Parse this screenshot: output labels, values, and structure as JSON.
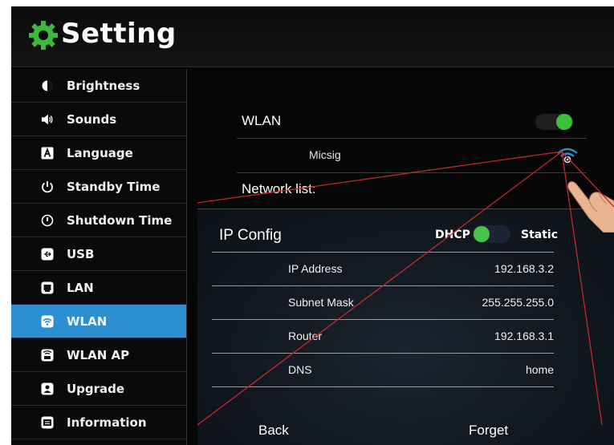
{
  "app": {
    "title": "Setting"
  },
  "sidebar": {
    "items": [
      {
        "label": "Brightness",
        "icon": "brightness-icon"
      },
      {
        "label": "Sounds",
        "icon": "speaker-icon"
      },
      {
        "label": "Language",
        "icon": "language-icon"
      },
      {
        "label": "Standby Time",
        "icon": "power-icon"
      },
      {
        "label": "Shutdown Time",
        "icon": "shutdown-icon"
      },
      {
        "label": "USB",
        "icon": "usb-icon"
      },
      {
        "label": "LAN",
        "icon": "lan-icon"
      },
      {
        "label": "WLAN",
        "icon": "wifi-icon",
        "active": true
      },
      {
        "label": "WLAN AP",
        "icon": "wlan-ap-icon"
      },
      {
        "label": "Upgrade",
        "icon": "upgrade-icon"
      },
      {
        "label": "Information",
        "icon": "information-icon"
      }
    ]
  },
  "wlan": {
    "label": "WLAN",
    "enabled": true,
    "connected_network": "Micsig",
    "network_list_label": "Network list:"
  },
  "ip_config": {
    "title": "IP Config",
    "dhcp_label": "DHCP",
    "static_label": "Static",
    "mode": "DHCP",
    "rows": [
      {
        "key": "IP Address",
        "value": "192.168.3.2"
      },
      {
        "key": "Subnet Mask",
        "value": "255.255.255.0"
      },
      {
        "key": "Router",
        "value": "192.168.3.1"
      },
      {
        "key": "DNS",
        "value": "home"
      }
    ],
    "back_label": "Back",
    "forget_label": "Forget"
  },
  "colors": {
    "accent": "#2b8fd0",
    "toggle_on": "#3cc23c",
    "background": "#050505",
    "callout_lines": "#c0282c"
  }
}
